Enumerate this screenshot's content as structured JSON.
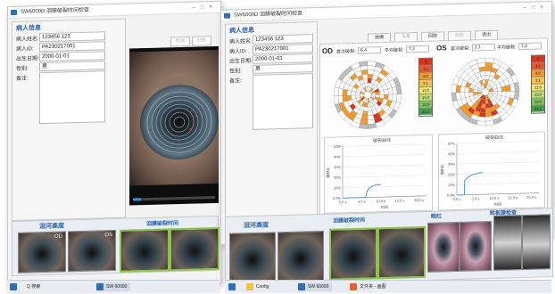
{
  "app_title": "SW6000D 泪膜破裂时间检查",
  "patient": {
    "section_title": "病人信息",
    "name_label": "病人姓名:",
    "name_value": "123456 123",
    "id_label": "病人ID:",
    "id_value": "PA230217001",
    "dob_label": "出生日期:",
    "dob_value": "2000-01-01",
    "sex_label": "性别:",
    "sex_value": "男",
    "notes_label": "备注:"
  },
  "toolbar_left": [
    "检测",
    "分析"
  ],
  "toolbar_right": [
    "拍摄",
    "采集",
    "回放",
    "回放",
    "退出"
  ],
  "right_window": {
    "od_label": "OD",
    "os_label": "OS",
    "od_first_label": "首次破裂:",
    "od_first_value": "6.4",
    "od_avg_label": "平均破裂:",
    "od_avg_value": "7.2",
    "os_first_label": "首次破裂:",
    "os_first_value": "2.1",
    "os_avg_label": "平均破裂:",
    "os_avg_value": "7.2",
    "scale_values": [
      "0",
      "3.1",
      "6.0",
      "9.1",
      "12.0",
      "15.0",
      "18.0",
      "21.1"
    ],
    "chart_left_title": "破裂曲线",
    "chart_right_title": "破裂曲线",
    "y_ticks": [
      "50%",
      "40%",
      "30%",
      "20%",
      "10%",
      "0.0%"
    ],
    "x_ticks": [
      "0.0 s",
      "5.0 s",
      "10.0 s",
      "15.0 s",
      "20.0 s"
    ],
    "y_axis_label": "面积比",
    "x_axis_label": "时间"
  },
  "thumb_tabs": {
    "left_1": "泪河高度",
    "left_2": "泪膜破裂时间",
    "right_1": "泪河高度",
    "right_2": "泪膜破裂时间",
    "right_3": "眼红",
    "right_4": "睑板腺检查"
  },
  "thumb_labels": [
    "OD",
    "OS"
  ],
  "taskbar_left": [
    "Q 搜索",
    "SW 60000"
  ],
  "taskbar_right": [
    "Config",
    "SW 60000",
    "文件夹 - 画图"
  ],
  "colors": {
    "accent": "#2b62a8",
    "orange": "#f29a2e",
    "red": "#d9321f",
    "grey_sector": "#bdbdbd",
    "curve": "#3a8fd8"
  },
  "chart_data": [
    {
      "type": "line",
      "title": "破裂曲线",
      "xlabel": "时间",
      "ylabel": "面积比",
      "x_ticks": [
        "0.0 s",
        "5.0 s",
        "10.0 s",
        "15.0 s",
        "20.0 s"
      ],
      "y_ticks": [
        "0.0%",
        "10%",
        "20%",
        "30%",
        "40%",
        "50%"
      ],
      "xlim": [
        0,
        22
      ],
      "ylim": [
        0,
        50
      ],
      "series": [
        {
          "x": [
            0,
            6.0,
            6.4,
            7,
            8,
            9,
            10
          ],
          "y": [
            0,
            0,
            6,
            9,
            11,
            12,
            12
          ]
        }
      ]
    },
    {
      "type": "line",
      "title": "破裂曲线",
      "xlabel": "时间",
      "ylabel": "面积比",
      "x_ticks": [
        "0.0 s",
        "5.0 s",
        "10.0 s",
        "15.0 s",
        "20.0 s"
      ],
      "y_ticks": [
        "0.0%",
        "10%",
        "20%",
        "30%",
        "40%",
        "50%"
      ],
      "xlim": [
        0,
        22
      ],
      "ylim": [
        0,
        50
      ],
      "series": [
        {
          "x": [
            0,
            2.0,
            2.1,
            3,
            4,
            5,
            6,
            7
          ],
          "y": [
            0,
            0,
            14,
            17,
            19,
            20,
            21,
            21
          ]
        }
      ]
    }
  ]
}
